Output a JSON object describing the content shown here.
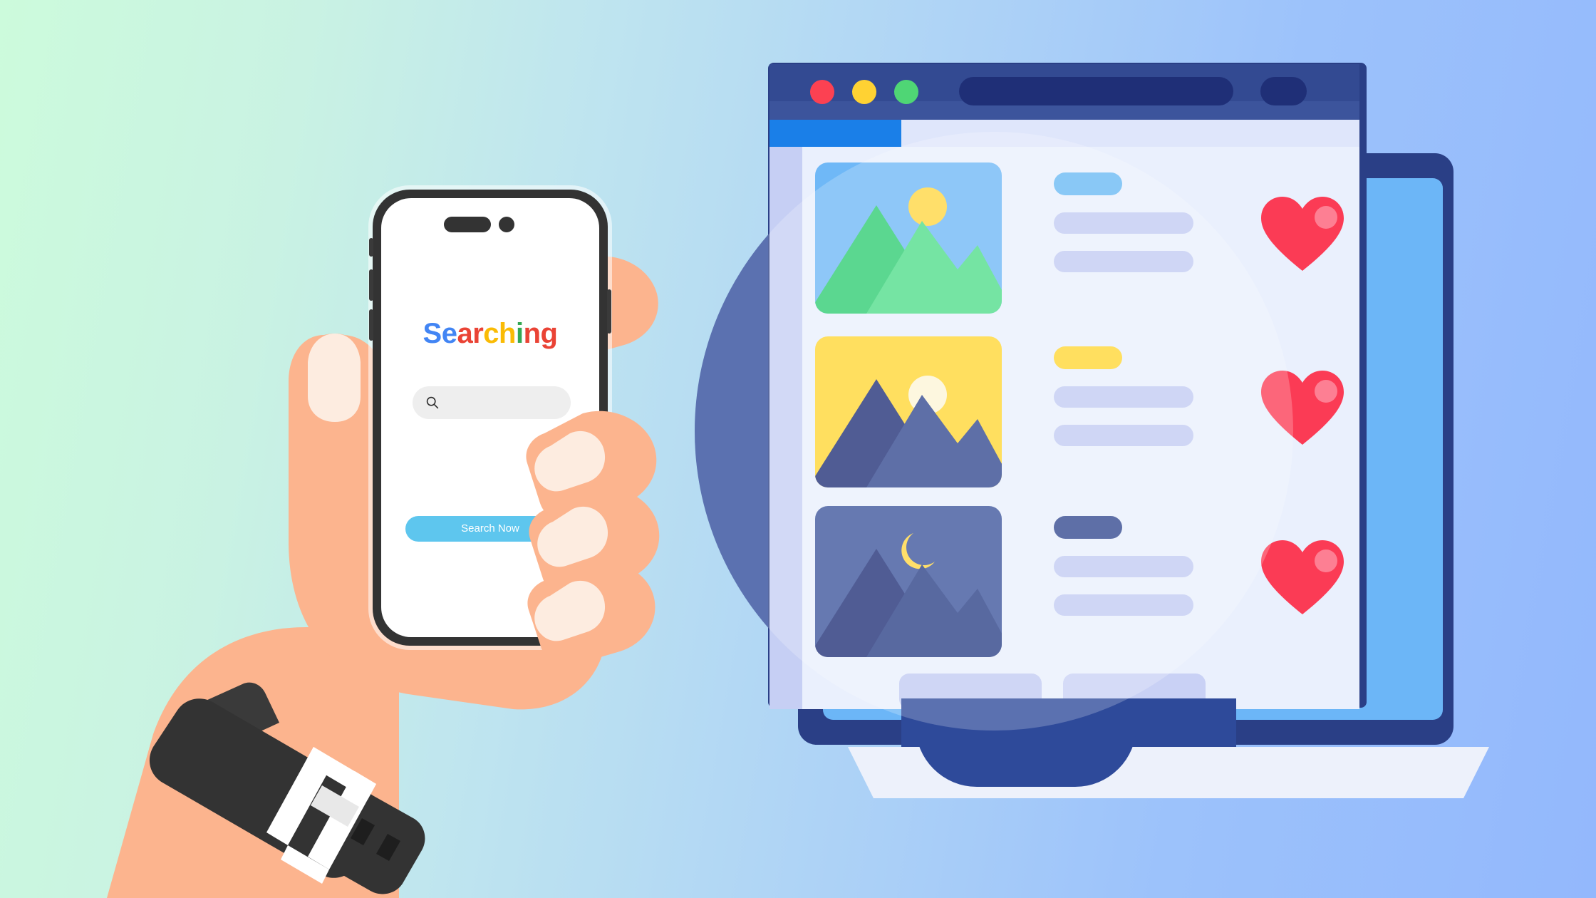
{
  "scene": {
    "title": "Mobile search app illustration",
    "background": {
      "gradient_from": "#ccfbdc",
      "gradient_mid": "#bfe5ef",
      "gradient_to": "#93b8fc"
    },
    "accent_circle_color": "#2e4a9a"
  },
  "phone": {
    "frame_color": "#333333",
    "screen_color": "#ffffff",
    "brand": {
      "letters": [
        {
          "char": "S",
          "color": "#4285f4",
          "class": "b"
        },
        {
          "char": "e",
          "color": "#4285f4",
          "class": "b"
        },
        {
          "char": "a",
          "color": "#ea4335",
          "class": "r"
        },
        {
          "char": "r",
          "color": "#ea4335",
          "class": "r"
        },
        {
          "char": "c",
          "color": "#fabb05",
          "class": "y"
        },
        {
          "char": "h",
          "color": "#fabb05",
          "class": "y"
        },
        {
          "char": "i",
          "color": "#34a853",
          "class": "g"
        },
        {
          "char": "n",
          "color": "#ea4335",
          "class": "r"
        },
        {
          "char": "g",
          "color": "#ea4335",
          "class": "r"
        }
      ],
      "text": "Searching"
    },
    "search": {
      "value": "",
      "placeholder": "",
      "icon": "search-icon",
      "field_color": "#eeeeee"
    },
    "cta_button": {
      "label": "Search Now",
      "color": "#5ec6ee",
      "text_color": "#ffffff"
    },
    "notch": {
      "island": "dynamic-island",
      "camera": "front-camera-dot"
    },
    "side_buttons": [
      "volume-up",
      "volume-down",
      "power"
    ]
  },
  "hand": {
    "skin_color": "#fcb48e",
    "skin_shade": "#f6a183",
    "nail_color": "#fdece0",
    "watch": {
      "strap_color": "#3a3a3a",
      "buckle_color": "#ffffff"
    }
  },
  "browser": {
    "titlebar_color": "#334a92",
    "traffic_lights": [
      {
        "name": "close",
        "color": "#fc4152"
      },
      {
        "name": "minimize",
        "color": "#ffd233"
      },
      {
        "name": "maximize",
        "color": "#4fd675"
      }
    ],
    "address_bar": {
      "value": "",
      "placeholder": ""
    },
    "tab_active_color": "#1a7fe8",
    "body_color": "#eaf0fd",
    "rows": [
      {
        "id": "row-sunny-mountain",
        "thumbnail": {
          "name": "mountain-sun-image",
          "sky": "#6fb8f7",
          "mountain_back": "#2ecc71",
          "mountain_front": "#4fdd8a",
          "sun": "#ffd740"
        },
        "title_bar_color": "#68b9f4",
        "line_color": "#c2cbf2",
        "favorite": {
          "name": "heart-icon",
          "color": "#fb3b55",
          "highlight": "#fd7f93",
          "active": true
        }
      },
      {
        "id": "row-sunset-mountain",
        "thumbnail": {
          "name": "mountain-sunset-image",
          "sky": "#ffd633",
          "mountain_back": "#1f2f77",
          "mountain_front": "#31478f",
          "sun": "#fdf5d6"
        },
        "title_bar_color": "#ffd633",
        "line_color": "#c2cbf2",
        "favorite": {
          "name": "heart-icon",
          "color": "#fb3b55",
          "highlight": "#fd7f93",
          "active": true
        }
      },
      {
        "id": "row-night-mountain",
        "thumbnail": {
          "name": "mountain-moon-image",
          "sky": "#3c549c",
          "mountain_back": "#1f2f77",
          "mountain_front": "#2a3f86",
          "moon": "#ffd740"
        },
        "title_bar_color": "#31478f",
        "line_color": "#c2cbf2",
        "favorite": {
          "name": "heart-icon",
          "color": "#fb3b55",
          "highlight": "#fd7f93",
          "active": true
        }
      }
    ]
  },
  "monitor": {
    "frame_color": "#2a3f86",
    "screen_inner_color": "#6cb6f7",
    "base_color": "#edf1fb"
  }
}
